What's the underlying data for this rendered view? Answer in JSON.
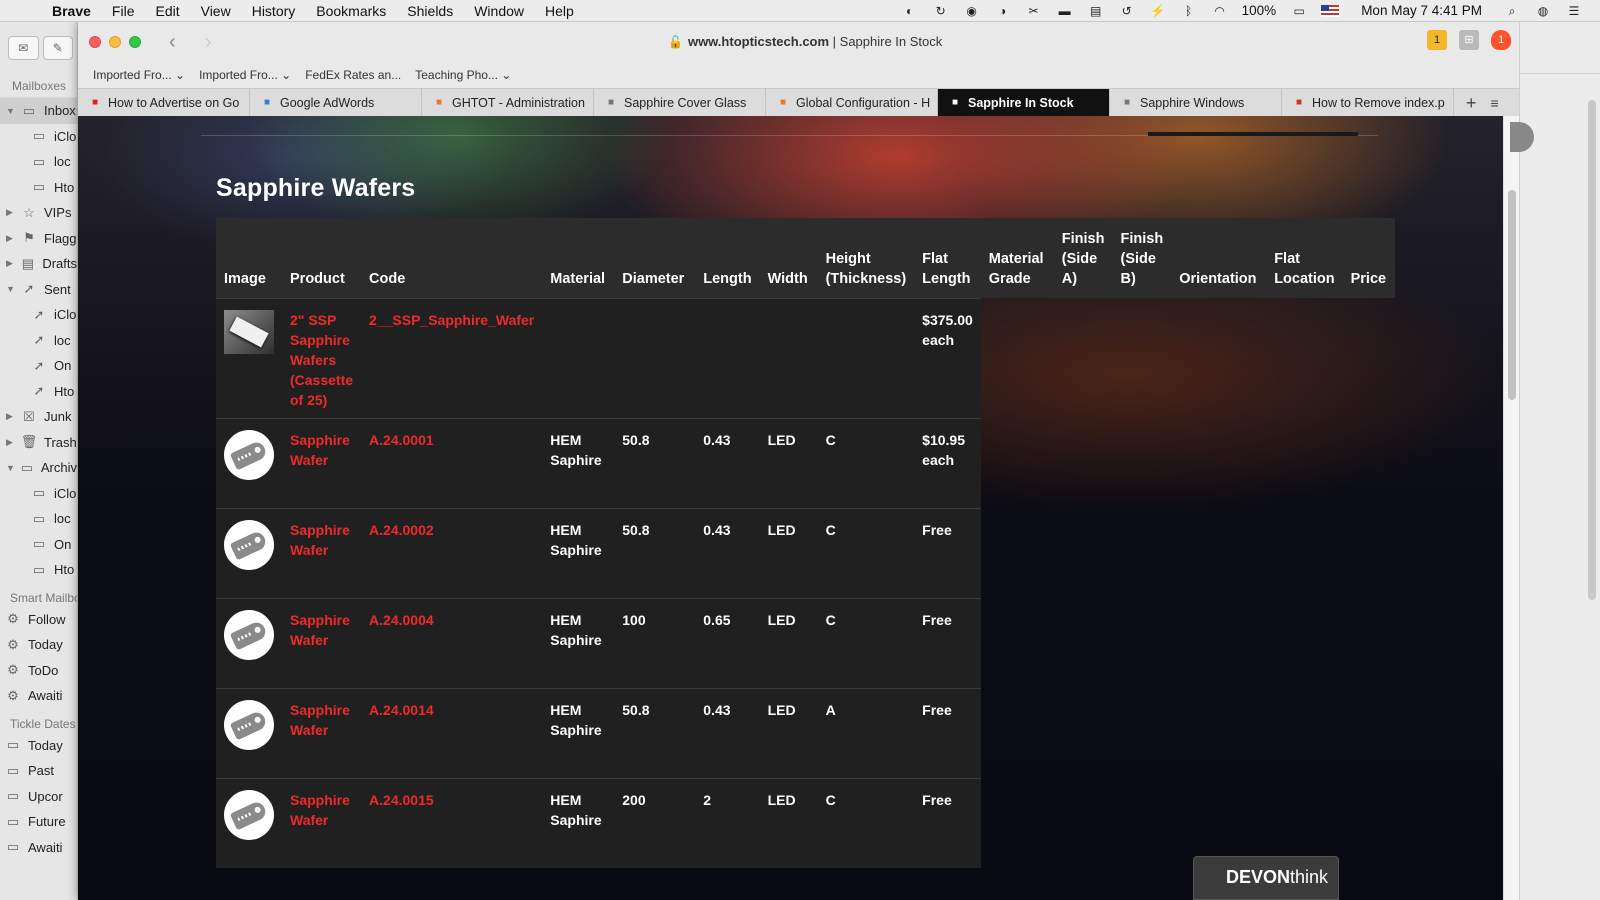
{
  "menubar": {
    "items": [
      "Brave",
      "File",
      "Edit",
      "View",
      "History",
      "Bookmarks",
      "Shields",
      "Window",
      "Help"
    ],
    "battery": "100%",
    "clock": "Mon May 7  4:41 PM"
  },
  "mail_sidebar": {
    "header": "Mailboxes",
    "rows": [
      {
        "label": "Inbox",
        "type": "top",
        "tri": "▼",
        "icon": "▭",
        "selected": true
      },
      {
        "label": "iClo",
        "type": "child",
        "icon": "▭"
      },
      {
        "label": "loc",
        "type": "child",
        "icon": "▭"
      },
      {
        "label": "Hto",
        "type": "child",
        "icon": "▭"
      },
      {
        "label": "VIPs",
        "type": "top",
        "tri": "▶",
        "icon": "☆"
      },
      {
        "label": "Flagg",
        "type": "top",
        "tri": "▶",
        "icon": "⚑"
      },
      {
        "label": "Drafts",
        "type": "top",
        "tri": "▶",
        "icon": "▤"
      },
      {
        "label": "Sent",
        "type": "top",
        "tri": "▼",
        "icon": "➚"
      },
      {
        "label": "iClo",
        "type": "child",
        "icon": "➚"
      },
      {
        "label": "loc",
        "type": "child",
        "icon": "➚"
      },
      {
        "label": "On",
        "type": "child",
        "icon": "➚"
      },
      {
        "label": "Hto",
        "type": "child",
        "icon": "➚"
      },
      {
        "label": "Junk",
        "type": "top",
        "tri": "▶",
        "icon": "☒"
      },
      {
        "label": "Trash",
        "type": "top",
        "tri": "▶",
        "icon": "🗑"
      },
      {
        "label": "Archiv",
        "type": "top",
        "tri": "▼",
        "icon": "▭"
      },
      {
        "label": "iClo",
        "type": "child",
        "icon": "▭"
      },
      {
        "label": "loc",
        "type": "child",
        "icon": "▭"
      },
      {
        "label": "On",
        "type": "child",
        "icon": "▭"
      },
      {
        "label": "Hto",
        "type": "child",
        "icon": "▭"
      }
    ],
    "smart_header": "Smart Mailbo",
    "smart": [
      "Follow",
      "Today",
      "ToDo",
      "Awaiti"
    ],
    "tickle_header": "Tickle Dates",
    "tickle": [
      "Today",
      "Past",
      "Upcor",
      "Future",
      "Awaiti"
    ]
  },
  "browser": {
    "address_host": "www.htopticstech.com",
    "address_sep": " | ",
    "address_title": "Sapphire In Stock",
    "extension_badges": [
      "1",
      "1"
    ],
    "bookmarks": [
      "Imported Fro... ⌄",
      "Imported Fro... ⌄",
      "FedEx Rates an...",
      "Teaching Pho... ⌄"
    ],
    "tabs": [
      {
        "label": "How to Advertise on Go",
        "favicon_color": "#e62117",
        "active": false
      },
      {
        "label": "Google AdWords",
        "favicon_color": "#3b7cd4",
        "active": false
      },
      {
        "label": "GHTOT - Administration",
        "favicon_color": "#e37a2c",
        "active": false
      },
      {
        "label": "Sapphire Cover Glass",
        "favicon_color": "#777777",
        "active": false
      },
      {
        "label": "Global Configuration - H",
        "favicon_color": "#e37a2c",
        "active": false
      },
      {
        "label": "Sapphire In Stock",
        "favicon_color": "#ffffff",
        "active": true
      },
      {
        "label": "Sapphire Windows",
        "favicon_color": "#777777",
        "active": false
      },
      {
        "label": "How to Remove index.p",
        "favicon_color": "#d23030",
        "active": false
      }
    ]
  },
  "page": {
    "title": "Sapphire Wafers",
    "columns": [
      "Image",
      "Product",
      "Code",
      "Material",
      "Diameter",
      "Length",
      "Width",
      "Height (Thickness)",
      "Flat Length",
      "Material Grade",
      "Finish (Side A)",
      "Finish (Side B)",
      "Orientation",
      "Flat Location",
      "Price"
    ],
    "rows": [
      {
        "image": "wafer-cassette-photo",
        "product": "2\" SSP Sapphire Wafers (Cassette of 25)",
        "code": "2__SSP_Sapphire_Wafer",
        "material": "",
        "diameter": "",
        "length": "",
        "width": "",
        "height": "",
        "price_col": "$375.00 each"
      },
      {
        "image": "price-tag-icon",
        "product": "Sapphire Wafer",
        "code": "A.24.0001",
        "material": "HEM Saphire",
        "diameter": "50.8",
        "length": "0.43",
        "width": "LED",
        "height": "C",
        "price_col": "$10.95 each"
      },
      {
        "image": "price-tag-icon",
        "product": "Sapphire Wafer",
        "code": "A.24.0002",
        "material": "HEM Saphire",
        "diameter": "50.8",
        "length": "0.43",
        "width": "LED",
        "height": "C",
        "price_col": "Free"
      },
      {
        "image": "price-tag-icon",
        "product": "Sapphire Wafer",
        "code": "A.24.0004",
        "material": "HEM Saphire",
        "diameter": "100",
        "length": "0.65",
        "width": "LED",
        "height": "C",
        "price_col": "Free"
      },
      {
        "image": "price-tag-icon",
        "product": "Sapphire Wafer",
        "code": "A.24.0014",
        "material": "HEM Saphire",
        "diameter": "50.8",
        "length": "0.43",
        "width": "LED",
        "height": "A",
        "price_col": "Free"
      },
      {
        "image": "price-tag-icon",
        "product": "Sapphire Wafer",
        "code": "A.24.0015",
        "material": "HEM Saphire",
        "diameter": "200",
        "length": "2",
        "width": "LED",
        "height": "C",
        "price_col": "Free"
      }
    ],
    "overlay": {
      "brand_bold": "DEVON",
      "brand_thin": "think"
    }
  },
  "colors": {
    "link_red": "#ee2a2a",
    "header_bg": "#2c2c2c",
    "row_bg": "#202020"
  }
}
